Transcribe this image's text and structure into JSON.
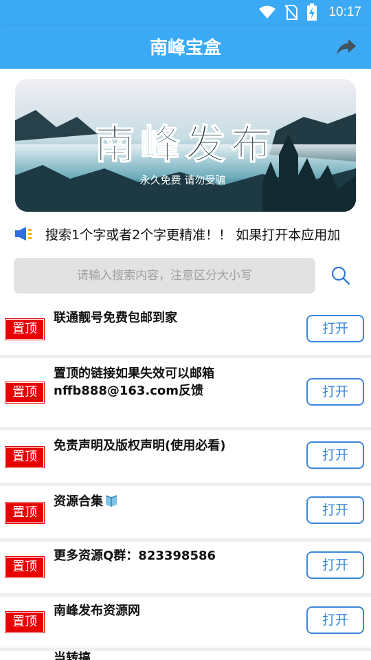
{
  "status": {
    "time": "10:17"
  },
  "header": {
    "title": "南峰宝盒"
  },
  "banner": {
    "title": "南峰发布",
    "subtitle": "永久免费 请勿受骗"
  },
  "notice": {
    "text": "搜索1个字或者2个字更精准！！ 如果打开本应用加"
  },
  "search": {
    "placeholder": "请输入搜索内容，注意区分大小写"
  },
  "pin_label": "置顶",
  "open_label": "打开",
  "items": [
    {
      "line1": "联通靓号免费包邮到家",
      "line2": ""
    },
    {
      "line1": "置顶的链接如果失效可以邮箱",
      "line2": "nffb888@163.com反馈"
    },
    {
      "line1": "免责声明及版权声明(使用必看)",
      "line2": ""
    },
    {
      "line1": "资源合集",
      "line2": "",
      "icon": "book-icon"
    },
    {
      "line1": "更多资源Q群：823398586",
      "line2": ""
    },
    {
      "line1": "南峰发布资源网",
      "line2": ""
    },
    {
      "line1": "当转搞",
      "line2": ""
    }
  ],
  "colors": {
    "primary": "#3ba9f3",
    "pin": "#e60000",
    "button": "#3b86d9"
  }
}
